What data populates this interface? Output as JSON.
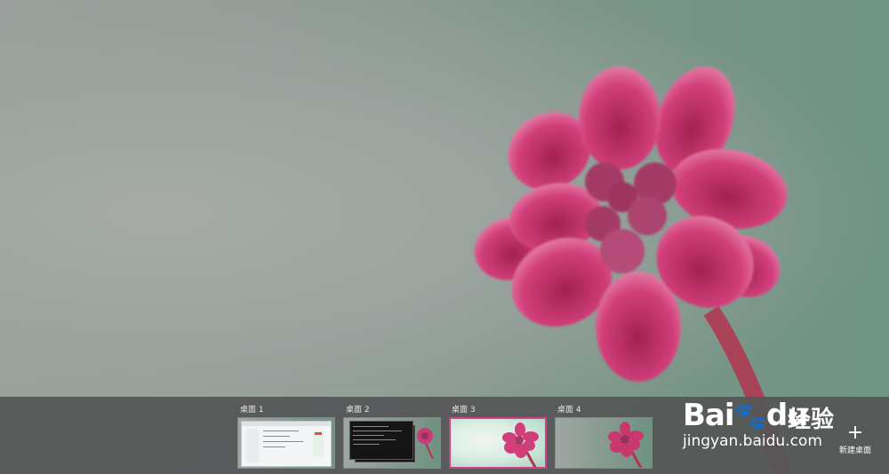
{
  "task_view": {
    "desktops": [
      {
        "label": "桌面 1",
        "active": false
      },
      {
        "label": "桌面 2",
        "active": false
      },
      {
        "label": "桌面 3",
        "active": true
      },
      {
        "label": "桌面 4",
        "active": false
      }
    ],
    "new_desktop_label": "新建桌面",
    "new_desktop_glyph": "+"
  },
  "watermark": {
    "brand": "Bai",
    "brand_tail": "du",
    "chinese": "经验",
    "url": "jingyan.baidu.com"
  },
  "colors": {
    "accent": "#d2418a",
    "petal": "#d2418a",
    "bar": "#545656"
  }
}
